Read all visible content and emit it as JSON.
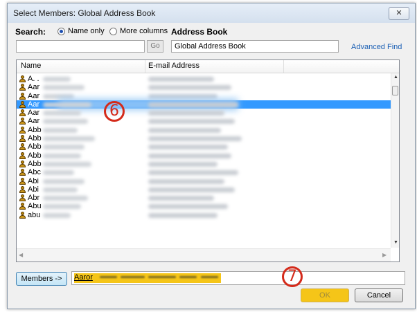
{
  "window": {
    "title": "Select Members: Global Address Book",
    "close_glyph": "✕"
  },
  "search": {
    "label": "Search:",
    "options": [
      "Name only",
      "More columns"
    ],
    "selected": "Name only",
    "value": "",
    "go_label": "Go"
  },
  "address_book": {
    "label": "Address Book",
    "value": "Global Address Book",
    "advanced_find": "Advanced Find"
  },
  "list": {
    "columns": [
      "Name",
      "E-mail Address"
    ],
    "rows": [
      {
        "name": "A. ."
      },
      {
        "name": "Aar"
      },
      {
        "name": "Aar"
      },
      {
        "name": "Aar"
      },
      {
        "name": "Aar"
      },
      {
        "name": "Aar"
      },
      {
        "name": "Abb"
      },
      {
        "name": "Abb"
      },
      {
        "name": "Abb"
      },
      {
        "name": "Abb"
      },
      {
        "name": "Abb"
      },
      {
        "name": "Abc"
      },
      {
        "name": "Abi"
      },
      {
        "name": "Abi"
      },
      {
        "name": "Abr"
      },
      {
        "name": "Abu"
      },
      {
        "name": "abu"
      }
    ],
    "selected_index": 3
  },
  "members": {
    "button_label": "Members ->",
    "value": "Aaror"
  },
  "buttons": {
    "ok": "OK",
    "cancel": "Cancel"
  },
  "callouts": {
    "step6": "6",
    "step7": "7"
  },
  "colors": {
    "selection": "#3399ff",
    "highlight": "#f5c518",
    "callout": "#d42a1a",
    "link": "#1a5fb4"
  }
}
